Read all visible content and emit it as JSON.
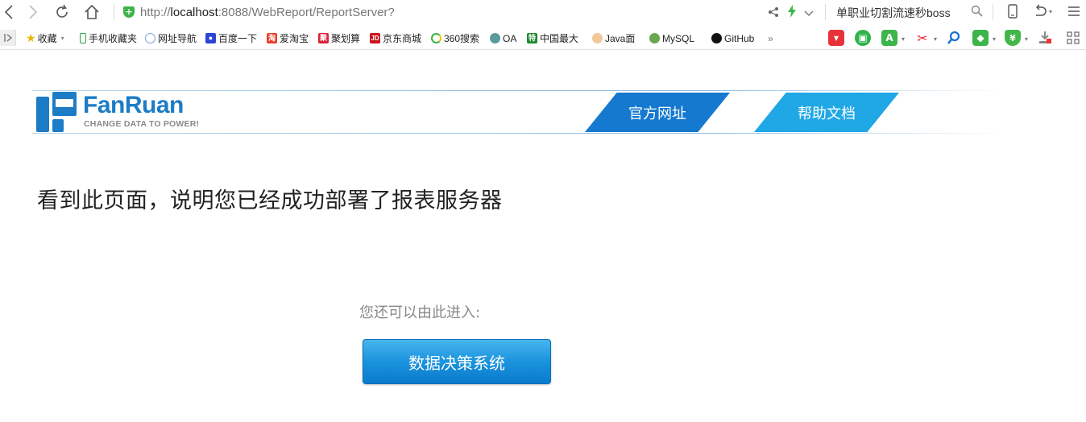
{
  "browser": {
    "url_scheme": "http://",
    "url_host": "localhost",
    "url_rest": ":8088/WebReport/ReportServer?",
    "search_suggestion": "单职业切割流速秒boss"
  },
  "bookmarks": [
    {
      "label": "收藏",
      "icon": "star-icon"
    },
    {
      "label": "手机收藏夹",
      "icon": "phone-icon"
    },
    {
      "label": "网址导航",
      "icon": "globe-icon"
    },
    {
      "label": "百度一下",
      "icon": "baidu-paw-icon"
    },
    {
      "label": "爱淘宝",
      "icon": "taobao-icon",
      "icon_text": "淘"
    },
    {
      "label": "聚划算",
      "icon": "juhuasuan-icon",
      "icon_text": "聚"
    },
    {
      "label": "京东商城",
      "icon": "jd-icon",
      "icon_text": "JD"
    },
    {
      "label": "360搜索",
      "icon": "360-search-icon"
    },
    {
      "label": "OA",
      "icon": "oa-icon"
    },
    {
      "label": "中国最大",
      "icon": "te-icon",
      "icon_text": "特"
    },
    {
      "label": "Java面",
      "icon": "person-icon"
    },
    {
      "label": "MySQL",
      "icon": "mysql-icon"
    },
    {
      "label": "GitHub",
      "icon": "github-icon"
    }
  ],
  "brand": {
    "name": "FanRuan",
    "tagline": "CHANGE DATA TO POWER!",
    "color": "#1d7cc6"
  },
  "tabs": {
    "official": "官方网址",
    "help": "帮助文档"
  },
  "headline": "看到此页面，说明您已经成功部署了报表服务器",
  "enter_prompt": "您还可以由此进入:",
  "decision_button": "数据决策系统"
}
